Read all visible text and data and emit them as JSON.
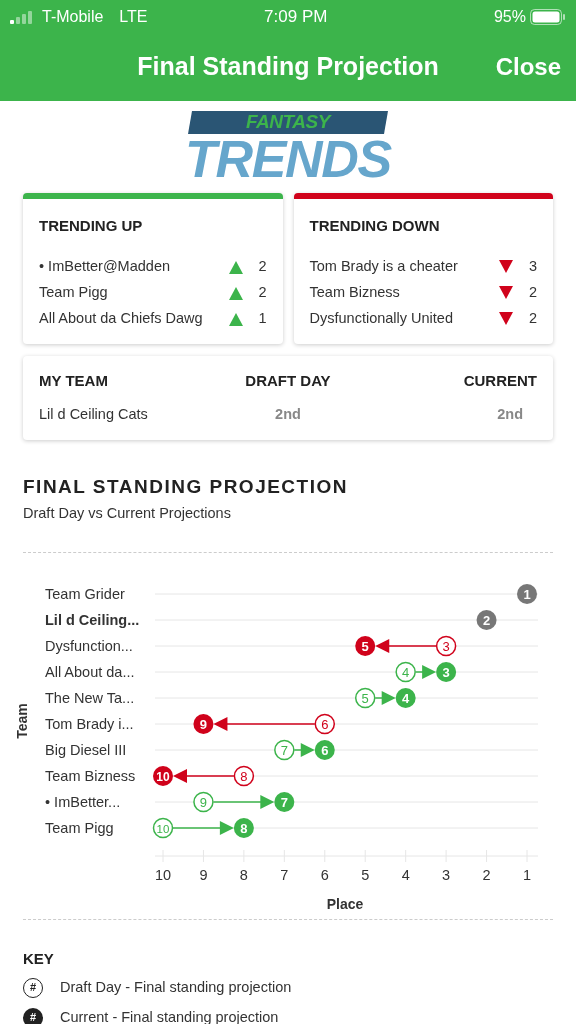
{
  "status_bar": {
    "carrier": "T-Mobile",
    "network": "LTE",
    "time": "7:09 PM",
    "battery": "95%"
  },
  "nav": {
    "title": "Final Standing Projection",
    "close": "Close"
  },
  "logo": {
    "top": "FANTASY",
    "bottom": "TRENDS"
  },
  "trend_cards": [
    {
      "kind": "up",
      "title": "TRENDING UP",
      "items": [
        {
          "team": "• ImBetter@Madden",
          "change": "2"
        },
        {
          "team": "Team Pigg",
          "change": "2"
        },
        {
          "team": "All About da Chiefs Dawg",
          "change": "1"
        }
      ]
    },
    {
      "kind": "down",
      "title": "TRENDING DOWN",
      "items": [
        {
          "team": "Tom Brady is a cheater",
          "change": "3"
        },
        {
          "team": "Team Bizness",
          "change": "2"
        },
        {
          "team": "Dysfunctionally United",
          "change": "2"
        }
      ]
    }
  ],
  "my_team": {
    "columns": [
      "MY TEAM",
      "DRAFT DAY",
      "CURRENT"
    ],
    "team": "Lil d Ceiling Cats",
    "draft_day": "2nd",
    "current": "2nd"
  },
  "projection": {
    "title": "FINAL STANDING PROJECTION",
    "subtitle": "Draft Day vs Current Projections",
    "plot": {
      "ylabel": "Team",
      "xlabel": "Place",
      "ticks": [
        "10",
        "9",
        "8",
        "7",
        "6",
        "5",
        "4",
        "3",
        "2",
        "1"
      ],
      "rows": [
        {
          "team": "Team Grider",
          "my_team": false,
          "kind": "same",
          "current": "1"
        },
        {
          "team": "Lil d Ceiling...",
          "my_team": true,
          "kind": "same",
          "current": "2"
        },
        {
          "team": "Dysfunction...",
          "my_team": false,
          "kind": "down",
          "draft": "3",
          "current": "5"
        },
        {
          "team": "All About da...",
          "my_team": false,
          "kind": "up",
          "draft": "4",
          "current": "3"
        },
        {
          "team": "The New Ta...",
          "my_team": false,
          "kind": "up",
          "draft": "5",
          "current": "4"
        },
        {
          "team": "Tom Brady i...",
          "my_team": false,
          "kind": "down",
          "draft": "6",
          "current": "9"
        },
        {
          "team": "Big Diesel III",
          "my_team": false,
          "kind": "up",
          "draft": "7",
          "current": "6"
        },
        {
          "team": "Team Bizness",
          "my_team": false,
          "kind": "down",
          "draft": "8",
          "current": "10"
        },
        {
          "team": "• ImBetter...",
          "my_team": false,
          "kind": "up",
          "draft": "9",
          "current": "7"
        },
        {
          "team": "Team Pigg",
          "my_team": false,
          "kind": "up",
          "draft": "10",
          "current": "8"
        }
      ]
    }
  },
  "key": {
    "title": "KEY",
    "items": [
      {
        "kind": "hollow",
        "symbol": "#",
        "label": "Draft Day - Final standing projection"
      },
      {
        "kind": "filled",
        "symbol": "#",
        "label": "Current - Final standing projection"
      }
    ]
  }
}
